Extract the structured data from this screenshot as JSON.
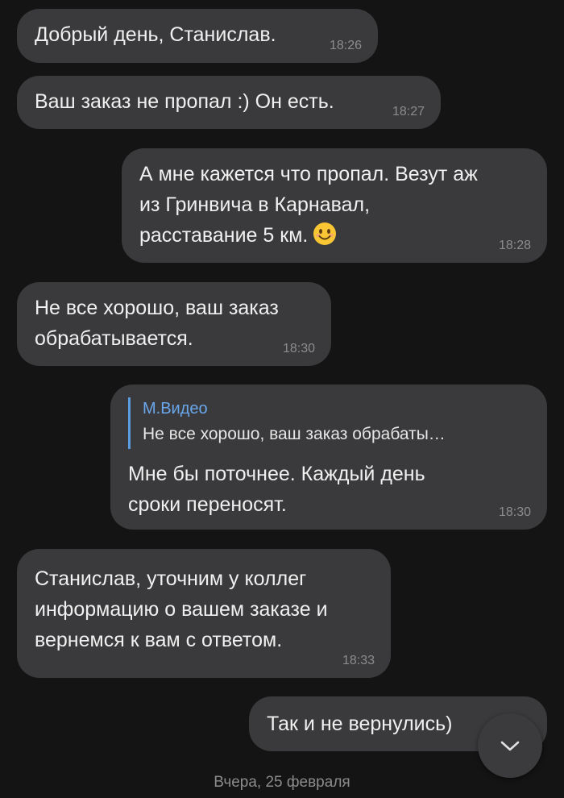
{
  "messages": [
    {
      "text": "Добрый день, Станислав.",
      "time": "18:26",
      "direction": "incoming"
    },
    {
      "text": "Ваш заказ не пропал :) Он есть.",
      "time": "18:27",
      "direction": "incoming"
    },
    {
      "text": "А мне кажется что пропал. Везут аж\nиз Гринвича в Карнавал,\nрасставание 5 км.",
      "emoji": "smiling-face-emoji",
      "time": "18:28",
      "direction": "outgoing"
    },
    {
      "text": "Не все хорошо, ваш заказ\nобрабатывается.",
      "time": "18:30",
      "direction": "incoming"
    },
    {
      "reply_author": "М.Видео",
      "reply_quote": "Не все хорошо, ваш заказ обрабаты…",
      "text": "Мне бы поточнее. Каждый день\nсроки переносят.",
      "time": "18:30",
      "direction": "outgoing"
    },
    {
      "text": "Станислав, уточним у коллег\nинформацию о вашем заказе и\nвернемся к вам с ответом.",
      "time": "18:33",
      "direction": "incoming"
    },
    {
      "text": "Так и не вернулись)",
      "direction": "outgoing"
    }
  ],
  "date_separator": "Вчера, 25 февраля",
  "scroll_button_icon": "chevron-down-icon",
  "colors": {
    "background": "#141414",
    "bubble": "#3a3a3c",
    "time": "#8c8c8e",
    "reply_accent": "#5b9be0"
  }
}
